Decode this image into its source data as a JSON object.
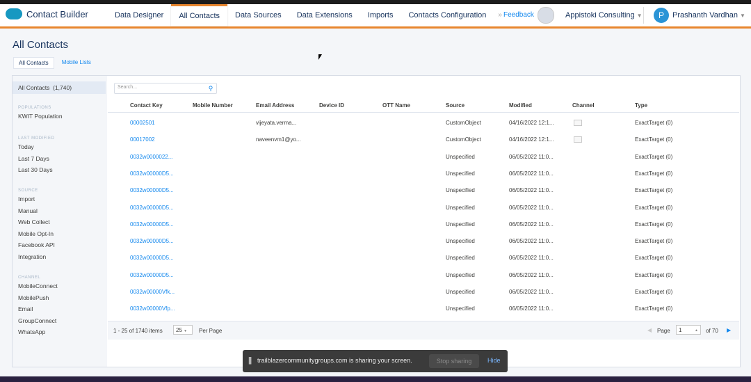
{
  "app": {
    "brand": "Contact Builder",
    "icon": "salesforce-cloud-icon"
  },
  "nav": {
    "tabs": [
      "Data Designer",
      "All Contacts",
      "Data Sources",
      "Data Extensions",
      "Imports",
      "Contacts Configuration"
    ],
    "more": "»"
  },
  "header": {
    "feedback": "Feedback",
    "org": "Appistoki Consulting",
    "user": "Prashanth Vardhan",
    "user_initial": "P"
  },
  "page": {
    "title": "All Contacts",
    "subtabs": [
      "All Contacts",
      "Mobile Lists"
    ]
  },
  "sidebar": {
    "selected_label": "All Contacts",
    "selected_count": "(1,740)",
    "groups": [
      {
        "heading": "POPULATIONS",
        "items": [
          "KWIT Population"
        ]
      },
      {
        "heading": "LAST MODIFIED",
        "items": [
          "Today",
          "Last 7 Days",
          "Last 30 Days"
        ]
      },
      {
        "heading": "SOURCE",
        "items": [
          "Import",
          "Manual",
          "Web Collect",
          "Mobile Opt-In",
          "Facebook API",
          "Integration"
        ]
      },
      {
        "heading": "CHANNEL",
        "items": [
          "MobileConnect",
          "MobilePush",
          "Email",
          "GroupConnect",
          "WhatsApp"
        ]
      }
    ]
  },
  "search": {
    "placeholder": "Search..."
  },
  "table": {
    "headers": [
      "Contact Key",
      "Mobile Number",
      "Email Address",
      "Device ID",
      "OTT Name",
      "Source",
      "Modified",
      "Channel",
      "Type"
    ],
    "rows": [
      {
        "key": "00002501",
        "mobile": "",
        "email": "vijeyata.verma...",
        "device": "",
        "ott": "",
        "source": "CustomObject",
        "modified": "04/16/2022 12:1...",
        "channel": "email",
        "type": "ExactTarget (0)"
      },
      {
        "key": "00017002",
        "mobile": "",
        "email": "naveenvm1@yo...",
        "device": "",
        "ott": "",
        "source": "CustomObject",
        "modified": "04/16/2022 12:1...",
        "channel": "email",
        "type": "ExactTarget (0)"
      },
      {
        "key": "0032w0000022...",
        "mobile": "",
        "email": "",
        "device": "",
        "ott": "",
        "source": "Unspecified",
        "modified": "06/05/2022 11:0...",
        "channel": "",
        "type": "ExactTarget (0)"
      },
      {
        "key": "0032w00000D5...",
        "mobile": "",
        "email": "",
        "device": "",
        "ott": "",
        "source": "Unspecified",
        "modified": "06/05/2022 11:0...",
        "channel": "",
        "type": "ExactTarget (0)"
      },
      {
        "key": "0032w00000D5...",
        "mobile": "",
        "email": "",
        "device": "",
        "ott": "",
        "source": "Unspecified",
        "modified": "06/05/2022 11:0...",
        "channel": "",
        "type": "ExactTarget (0)"
      },
      {
        "key": "0032w00000D5...",
        "mobile": "",
        "email": "",
        "device": "",
        "ott": "",
        "source": "Unspecified",
        "modified": "06/05/2022 11:0...",
        "channel": "",
        "type": "ExactTarget (0)"
      },
      {
        "key": "0032w00000D5...",
        "mobile": "",
        "email": "",
        "device": "",
        "ott": "",
        "source": "Unspecified",
        "modified": "06/05/2022 11:0...",
        "channel": "",
        "type": "ExactTarget (0)"
      },
      {
        "key": "0032w00000D5...",
        "mobile": "",
        "email": "",
        "device": "",
        "ott": "",
        "source": "Unspecified",
        "modified": "06/05/2022 11:0...",
        "channel": "",
        "type": "ExactTarget (0)"
      },
      {
        "key": "0032w00000D5...",
        "mobile": "",
        "email": "",
        "device": "",
        "ott": "",
        "source": "Unspecified",
        "modified": "06/05/2022 11:0...",
        "channel": "",
        "type": "ExactTarget (0)"
      },
      {
        "key": "0032w00000D5...",
        "mobile": "",
        "email": "",
        "device": "",
        "ott": "",
        "source": "Unspecified",
        "modified": "06/05/2022 11:0...",
        "channel": "",
        "type": "ExactTarget (0)"
      },
      {
        "key": "0032w00000Vfk...",
        "mobile": "",
        "email": "",
        "device": "",
        "ott": "",
        "source": "Unspecified",
        "modified": "06/05/2022 11:0...",
        "channel": "",
        "type": "ExactTarget (0)"
      },
      {
        "key": "0032w00000Vfp...",
        "mobile": "",
        "email": "",
        "device": "",
        "ott": "",
        "source": "Unspecified",
        "modified": "06/05/2022 11:0...",
        "channel": "",
        "type": "ExactTarget (0)"
      }
    ]
  },
  "pagination": {
    "summary": "1 - 25 of 1740 items",
    "per_page_value": "25",
    "per_page_label": "Per Page",
    "page_label": "Page",
    "page_value": "1",
    "of_pages": "of 70"
  },
  "sharing_bar": {
    "message": "trailblazercommunitygroups.com is sharing your screen.",
    "stop": "Stop sharing",
    "hide": "Hide"
  },
  "colors": {
    "accent": "#e8862e",
    "link": "#1589ee",
    "brand": "#1798c1"
  }
}
